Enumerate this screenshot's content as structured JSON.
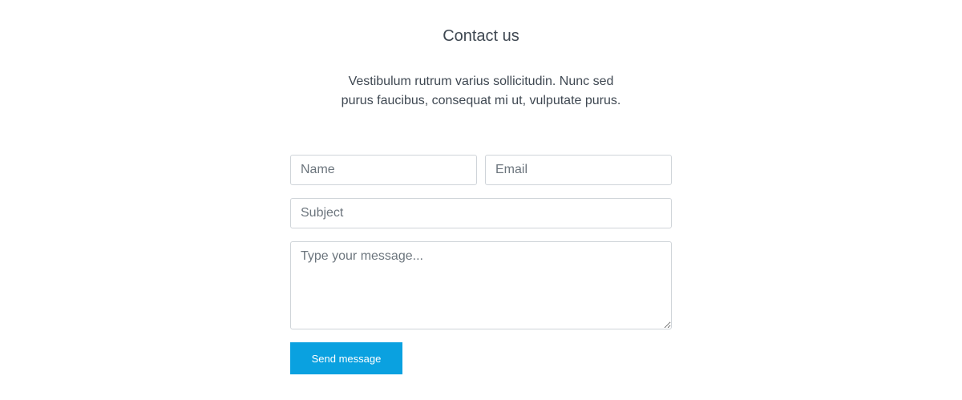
{
  "contact": {
    "title": "Contact us",
    "lead": "Vestibulum rutrum varius sollicitudin. Nunc sed purus faucibus, consequat mi ut, vulputate purus.",
    "form": {
      "name_placeholder": "Name",
      "email_placeholder": "Email",
      "subject_placeholder": "Subject",
      "message_placeholder": "Type your message...",
      "submit_label": "Send message"
    }
  },
  "colors": {
    "accent": "#0aa1e0",
    "text": "#3f4852",
    "border": "#cfd4d9",
    "placeholder": "#6c757d"
  }
}
